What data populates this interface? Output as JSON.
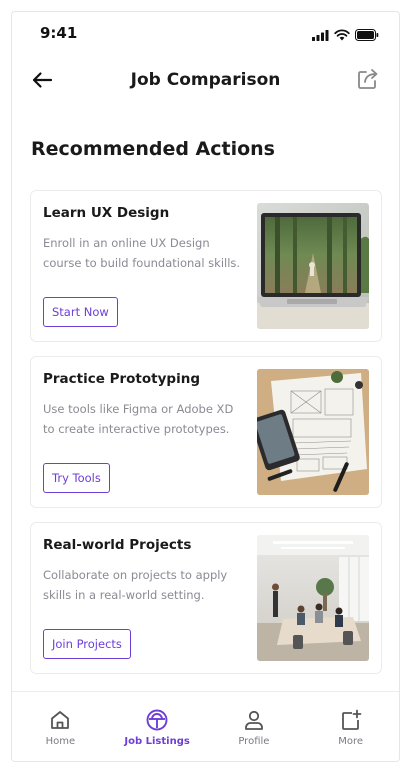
{
  "status_bar": {
    "time": "9:41",
    "icons": [
      "signal-icon",
      "wifi-icon",
      "battery-icon"
    ]
  },
  "header": {
    "title": "Job Comparison",
    "back_icon": "arrow-left-icon",
    "share_icon": "share-icon"
  },
  "main": {
    "section_title": "Recommended Actions",
    "cards": [
      {
        "title": "Learn UX Design",
        "description": "Enroll in an online UX Design course to build foundational skills.",
        "button_label": "Start Now",
        "image": "laptop-forest-photo"
      },
      {
        "title": "Practice Prototyping",
        "description": "Use tools like Figma or Adobe XD to create interactive prototypes.",
        "button_label": "Try Tools",
        "image": "wireframe-sketch-photo"
      },
      {
        "title": "Real-world Projects",
        "description": "Collaborate on projects to apply skills in a real-world setting.",
        "button_label": "Join Projects",
        "image": "office-meeting-photo"
      }
    ]
  },
  "tab_bar": {
    "items": [
      {
        "label": "Home",
        "icon": "home-icon",
        "active": false
      },
      {
        "label": "Job Listings",
        "icon": "job-listings-icon",
        "active": true
      },
      {
        "label": "Profile",
        "icon": "profile-icon",
        "active": false
      },
      {
        "label": "More",
        "icon": "more-icon",
        "active": false
      }
    ]
  },
  "colors": {
    "accent": "#6d3fd6",
    "text_primary": "#1a1a1a",
    "text_secondary": "#8a8a94",
    "border": "#ececef"
  }
}
